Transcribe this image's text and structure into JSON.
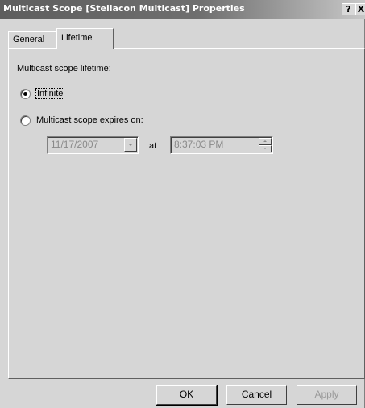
{
  "window": {
    "title": "Multicast Scope [Stellacon Multicast] Properties",
    "help_button": "?",
    "close_button": "X"
  },
  "tabs": [
    {
      "label": "General",
      "selected": false
    },
    {
      "label": "Lifetime",
      "selected": true
    }
  ],
  "lifetime": {
    "heading": "Multicast scope lifetime:",
    "options": [
      {
        "label": "Infinite",
        "selected": true
      },
      {
        "label": "Multicast scope expires on:",
        "selected": false
      }
    ],
    "date_value": "11/17/2007",
    "at_label": "at",
    "time_value": "8:37:03 PM",
    "fields_enabled": false
  },
  "buttons": {
    "ok": "OK",
    "cancel": "Cancel",
    "apply": "Apply"
  },
  "icons": {
    "date_dropdown": "chevron-down-icon",
    "time_spinner_up": "spin-up-icon",
    "time_spinner_down": "spin-down-icon"
  },
  "colors": {
    "dialog_background": "#d6d6d6",
    "titlebar_start": "#5e5e5e",
    "titlebar_end": "#c8c8c8",
    "disabled_text": "#8a8a8a"
  }
}
